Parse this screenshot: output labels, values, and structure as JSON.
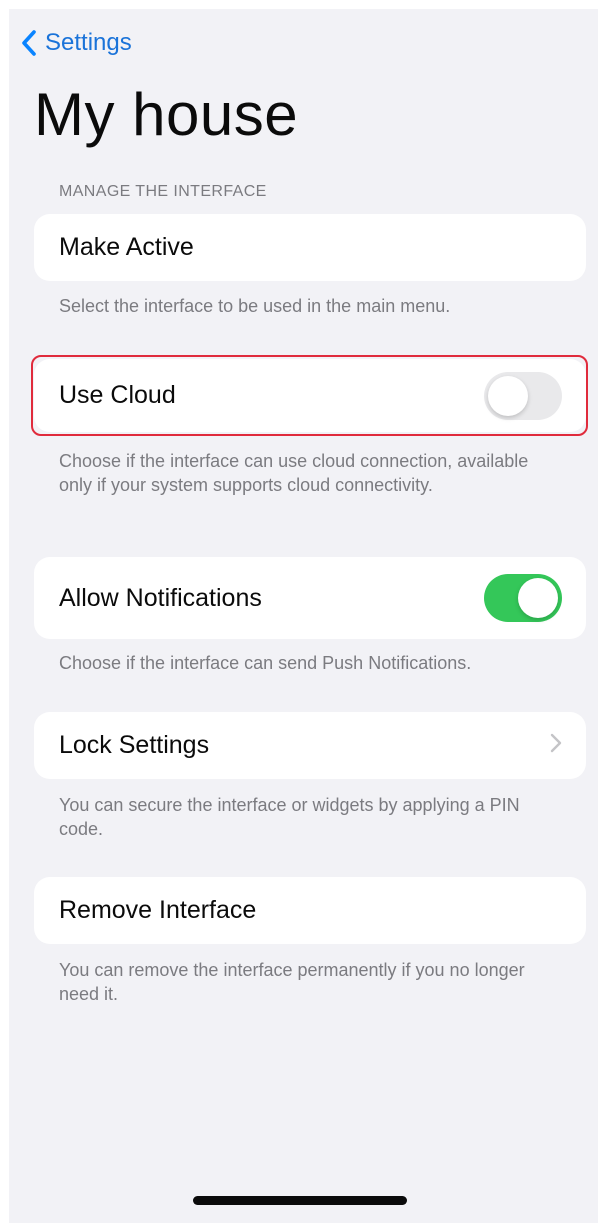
{
  "nav": {
    "back_label": "Settings"
  },
  "page": {
    "title": "My house"
  },
  "section": {
    "header": "MANAGE THE INTERFACE"
  },
  "rows": {
    "make_active": {
      "label": "Make Active",
      "footer": "Select the interface to be used in the main menu."
    },
    "use_cloud": {
      "label": "Use Cloud",
      "toggle_on": false,
      "footer": "Choose if the interface can use cloud connection, available only if your system supports cloud connectivity."
    },
    "allow_notifications": {
      "label": "Allow Notifications",
      "toggle_on": true,
      "footer": "Choose if the interface can send Push Notifications."
    },
    "lock_settings": {
      "label": "Lock Settings",
      "footer": "You can secure the interface or widgets by applying a PIN code."
    },
    "remove_interface": {
      "label": "Remove Interface",
      "footer": "You can remove the interface permanently if you no longer need it."
    }
  },
  "colors": {
    "background": "#f2f2f6",
    "accent": "#0a84ff",
    "toggle_on": "#34c759",
    "toggle_off": "#e9e9eb",
    "highlight": "#e02b3c",
    "secondary_text": "#7b7b80"
  },
  "icons": {
    "back": "chevron-left-icon",
    "disclosure": "chevron-right-icon"
  }
}
